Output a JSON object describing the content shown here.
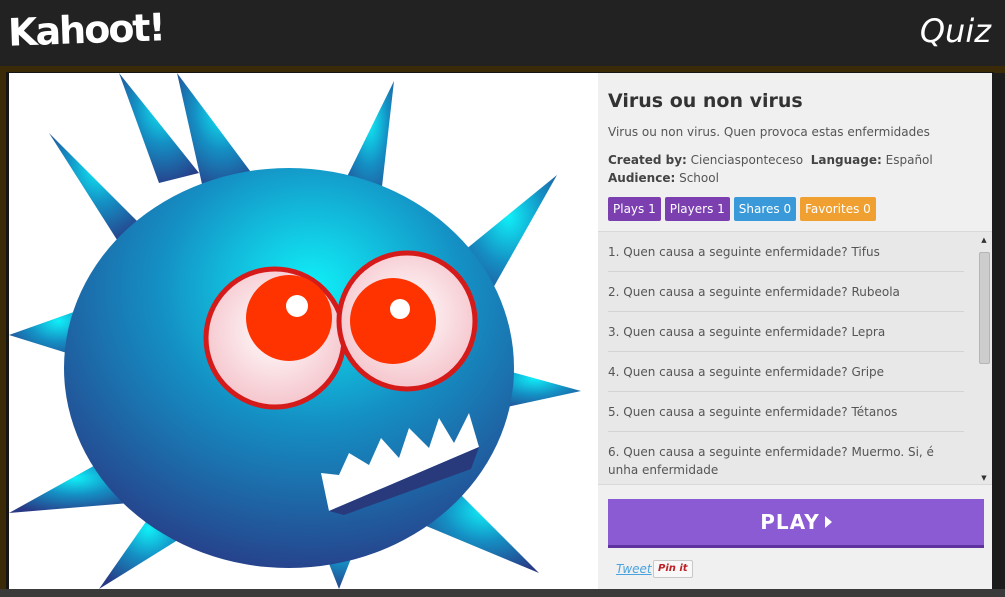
{
  "header": {
    "logo": "Kahoot!",
    "section_label": "Quiz"
  },
  "kahoot": {
    "title": "Virus ou non virus",
    "description": "Virus ou non virus. Quen provoca estas enfermidades",
    "created_by_label": "Created by:",
    "created_by": "Cienciasponteceso",
    "language_label": "Language:",
    "language": "Español",
    "audience_label": "Audience:",
    "audience": "School",
    "cover_image": "virus-cartoon-illustration"
  },
  "stats": {
    "plays": "Plays 1",
    "players": "Players 1",
    "shares": "Shares 0",
    "favorites": "Favorites 0"
  },
  "questions": [
    "1. Quen causa a seguinte enfermidade? Tifus",
    "2. Quen causa a seguinte enfermidade?  Rubeola",
    "3. Quen causa a seguinte enfermidade?  Lepra",
    "4. Quen causa a seguinte enfermidade? Gripe",
    "5. Quen causa a seguinte enfermidade? Tétanos",
    "6. Quen causa a seguinte enfermidade? Muermo. Si, é unha enfermidade"
  ],
  "actions": {
    "play": "PLAY",
    "tweet": "Tweet",
    "pin": "Pin it"
  },
  "colors": {
    "purple": "#7c3fb0",
    "blue": "#3a9ad9",
    "orange": "#f0a030",
    "play": "#8b5bd4"
  }
}
